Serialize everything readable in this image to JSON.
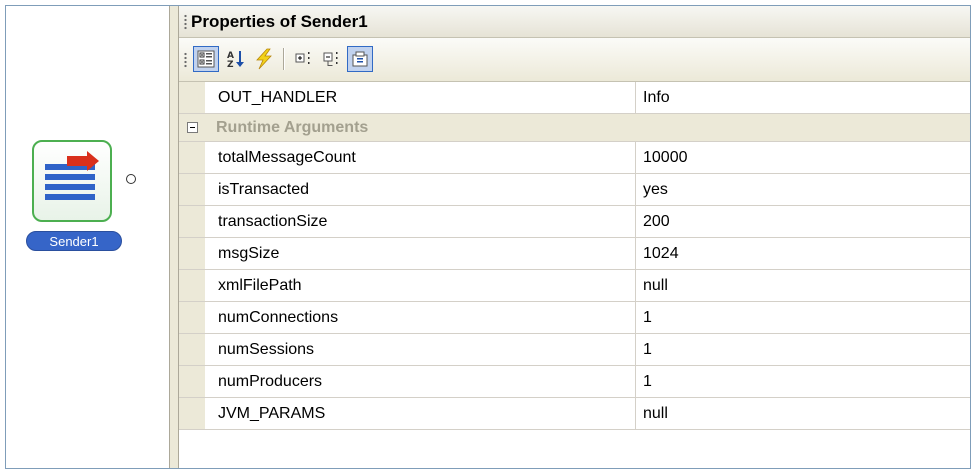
{
  "canvas": {
    "node_label": "Sender1"
  },
  "panel": {
    "title": "Properties of Sender1",
    "toolbar": [
      {
        "icon": "categorized-icon",
        "active": true
      },
      {
        "icon": "sort-alphabetical-icon",
        "active": false
      },
      {
        "icon": "events-icon",
        "active": false
      },
      {
        "icon": "expand-all-icon",
        "active": false
      },
      {
        "icon": "collapse-all-icon",
        "active": false
      },
      {
        "icon": "property-pages-icon",
        "active": true
      }
    ],
    "top_row": {
      "name": "OUT_HANDLER",
      "value": "Info"
    },
    "category": "Runtime Arguments",
    "rows": [
      {
        "name": "totalMessageCount",
        "value": "10000"
      },
      {
        "name": "isTransacted",
        "value": "yes"
      },
      {
        "name": "transactionSize",
        "value": "200"
      },
      {
        "name": "msgSize",
        "value": "1024"
      },
      {
        "name": "xmlFilePath",
        "value": "null"
      },
      {
        "name": "numConnections",
        "value": "1"
      },
      {
        "name": "numSessions",
        "value": "1"
      },
      {
        "name": "numProducers",
        "value": "1"
      },
      {
        "name": "JVM_PARAMS",
        "value": "null"
      }
    ]
  },
  "colors": {
    "node_border": "#4caf50",
    "node_label_bg": "#3665c8",
    "category_text": "#a3a08f",
    "active_button": "#c1d2ee"
  }
}
